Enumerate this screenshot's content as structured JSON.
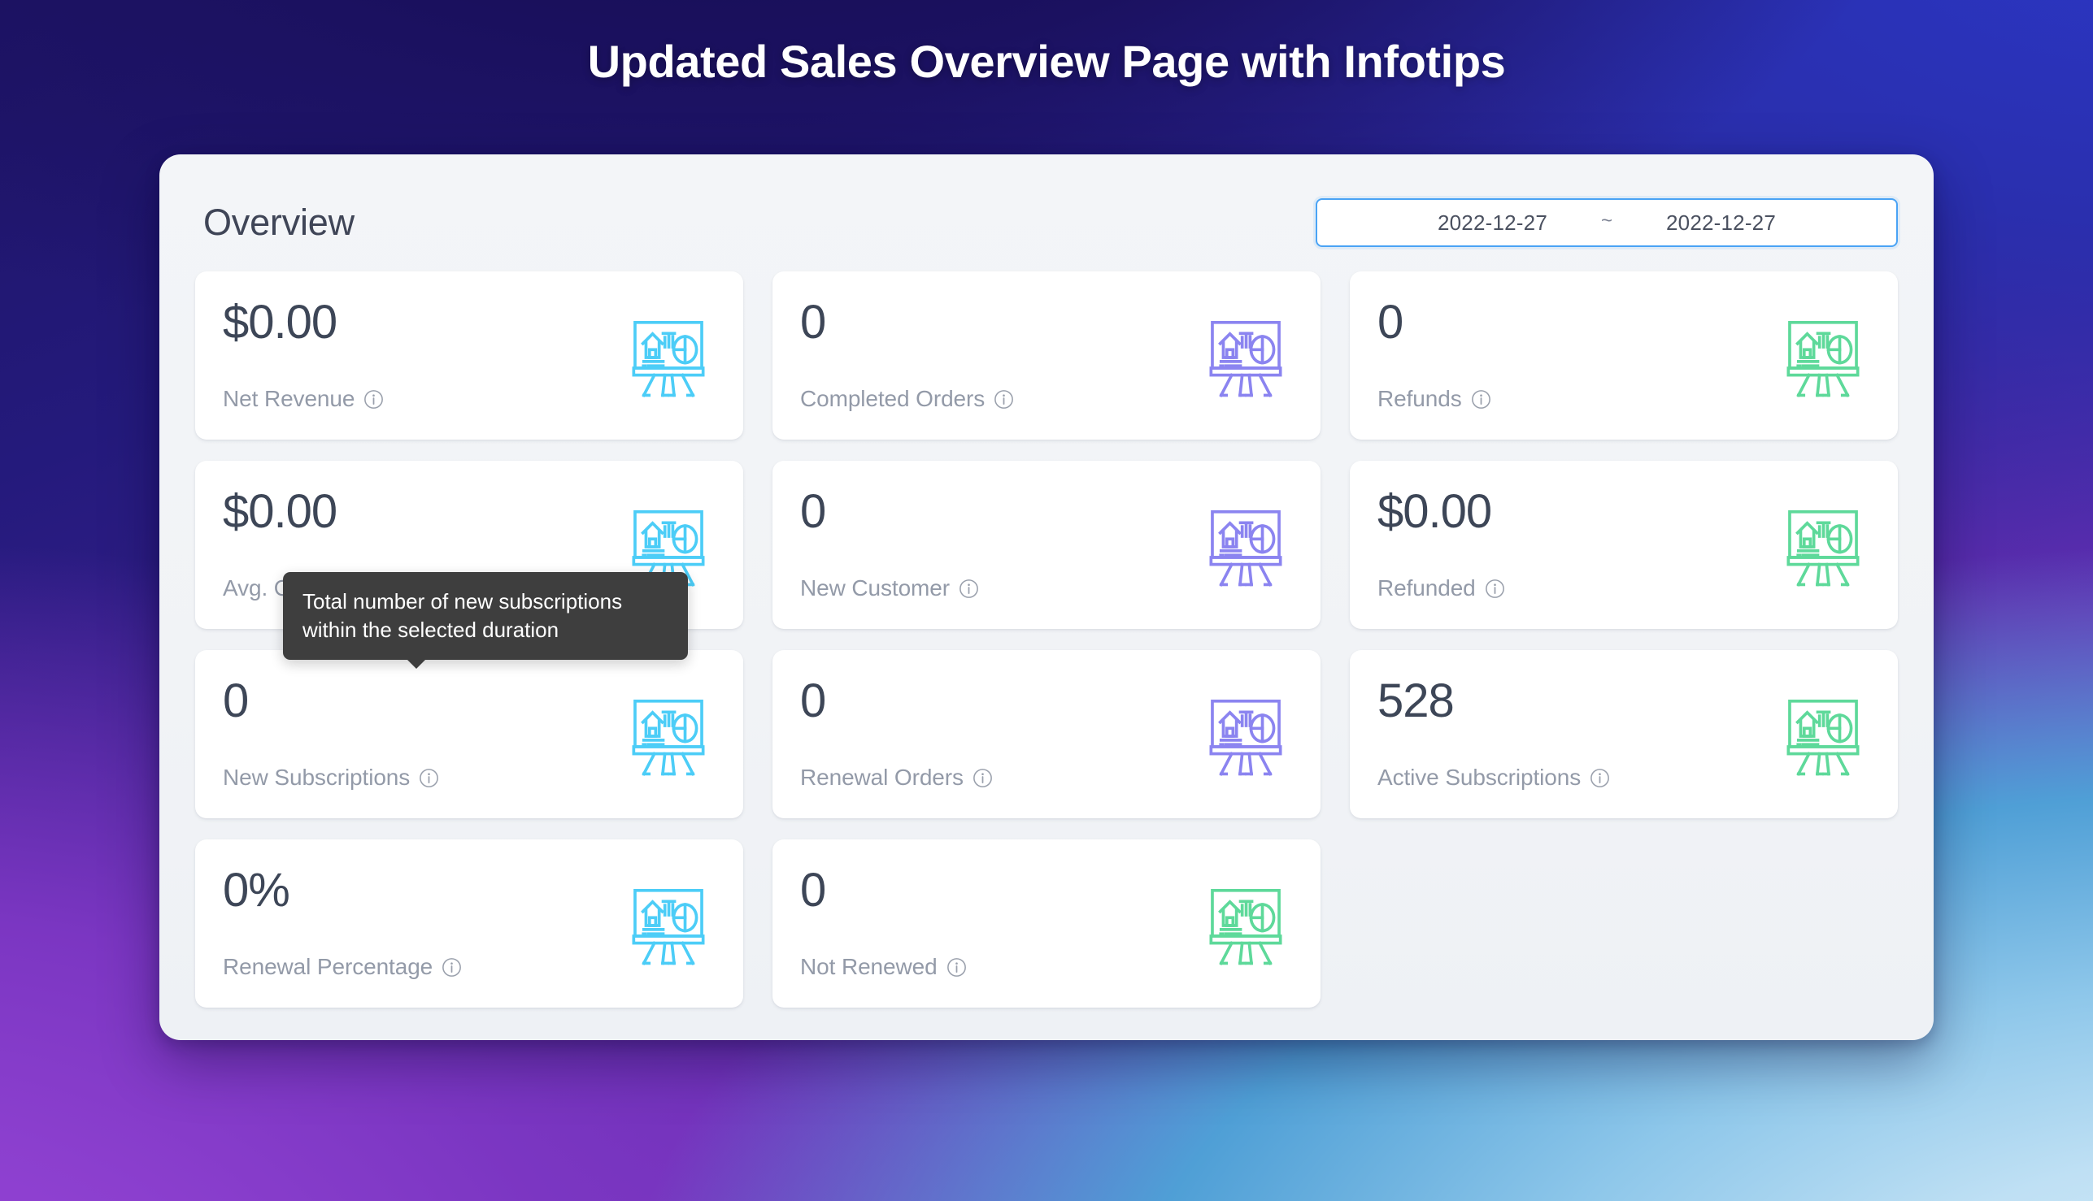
{
  "page": {
    "title": "Updated Sales Overview Page with Infotips"
  },
  "panel": {
    "heading": "Overview",
    "date_range": {
      "start": "2022-12-27",
      "separator": "~",
      "end": "2022-12-27"
    }
  },
  "colors": {
    "icon_cyan": "#4ccdf7",
    "icon_purple": "#8b84f0",
    "icon_green": "#5ed99a",
    "value_text": "#3d4657",
    "label_text": "#939aa8",
    "panel_bg": "#f2f4f7",
    "card_bg": "#ffffff",
    "date_border": "#4aa3f5",
    "tooltip_bg": "#3e3e3e",
    "bg_top_left": "#1e1466",
    "bg_top_right": "#2b36c4",
    "bg_bottom_left": "#8b3fce",
    "bg_bottom_right": "#bfe0f4"
  },
  "tooltip": {
    "visible_for": "new-subscriptions",
    "text": "Total number of new subscriptions within the selected duration"
  },
  "cards": [
    {
      "id": "net-revenue",
      "value": "$0.00",
      "label": "Net Revenue",
      "icon": "easel-chart-icon",
      "icon_color": "cyan",
      "info": "info-icon"
    },
    {
      "id": "completed-orders",
      "value": "0",
      "label": "Completed Orders",
      "icon": "easel-chart-icon",
      "icon_color": "purple",
      "info": "info-icon"
    },
    {
      "id": "refunds",
      "value": "0",
      "label": "Refunds",
      "icon": "easel-chart-icon",
      "icon_color": "green",
      "info": "info-icon"
    },
    {
      "id": "avg-order-value",
      "value": "$0.00",
      "label": "Avg. Order Value",
      "icon": "easel-chart-icon",
      "icon_color": "cyan",
      "info": "info-icon"
    },
    {
      "id": "new-customer",
      "value": "0",
      "label": "New Customer",
      "icon": "easel-chart-icon",
      "icon_color": "purple",
      "info": "info-icon"
    },
    {
      "id": "refunded",
      "value": "$0.00",
      "label": "Refunded",
      "icon": "easel-chart-icon",
      "icon_color": "green",
      "info": "info-icon"
    },
    {
      "id": "new-subscriptions",
      "value": "0",
      "label": "New Subscriptions",
      "icon": "easel-chart-icon",
      "icon_color": "cyan",
      "info": "info-icon"
    },
    {
      "id": "renewal-orders",
      "value": "0",
      "label": "Renewal Orders",
      "icon": "easel-chart-icon",
      "icon_color": "purple",
      "info": "info-icon"
    },
    {
      "id": "active-subscriptions",
      "value": "528",
      "label": "Active Subscriptions",
      "icon": "easel-chart-icon",
      "icon_color": "green",
      "info": "info-icon"
    },
    {
      "id": "renewal-percentage",
      "value": "0%",
      "label": "Renewal Percentage",
      "icon": "easel-chart-icon",
      "icon_color": "cyan",
      "info": "info-icon"
    },
    {
      "id": "not-renewed",
      "value": "0",
      "label": "Not Renewed",
      "icon": "easel-chart-icon",
      "icon_color": "green",
      "info": "info-icon"
    }
  ]
}
